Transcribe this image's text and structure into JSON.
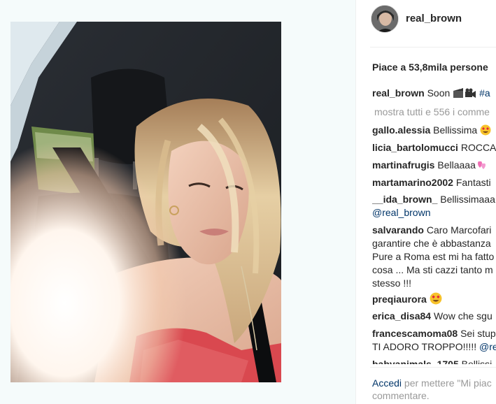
{
  "post": {
    "username": "real_brown",
    "likes_text": "Piace a 53,8mila persone"
  },
  "caption": {
    "username": "real_brown",
    "text": "Soon",
    "hashtag": "#a"
  },
  "view_all": "mostra tutti e 556 i comme",
  "comments": [
    {
      "user": "gallo.alessia",
      "text": "Bellissima",
      "emoji": "heart-eyes"
    },
    {
      "user": "licia_bartolomucci",
      "text": "ROCCA"
    },
    {
      "user": "martinafrugis",
      "text": "Bellaaaa",
      "emoji": "two-hearts"
    },
    {
      "user": "martamarino2002",
      "text": "Fantasti"
    },
    {
      "user": "__ida_brown_",
      "text": "Bellissimaaa",
      "mention": "@real_brown"
    },
    {
      "user": "salvarando",
      "text": "Caro Marcofari",
      "lines": [
        "garantire che è abbastanza",
        "Pure a Roma est mi ha fatto",
        "cosa ... Ma sti cazzi tanto m",
        "stesso !!!"
      ]
    },
    {
      "user": "preqiaurora",
      "text": "",
      "emoji": "heart-eyes"
    },
    {
      "user": "erica_disa84",
      "text": "Wow che sgu"
    },
    {
      "user": "francescamoma08",
      "text": "Sei stup",
      "line2": "TI ADORO TROPPO!!!!!",
      "mention": "@re"
    },
    {
      "user": "babyanimals_1705",
      "text": "Bellissi"
    }
  ],
  "footer": {
    "login": "Accedi",
    "text": "per mettere \"Mi piac",
    "text2": "commentare."
  },
  "colors": {
    "username": "#262626",
    "link": "#003569",
    "muted": "#999999",
    "dress": "#d9484f"
  }
}
